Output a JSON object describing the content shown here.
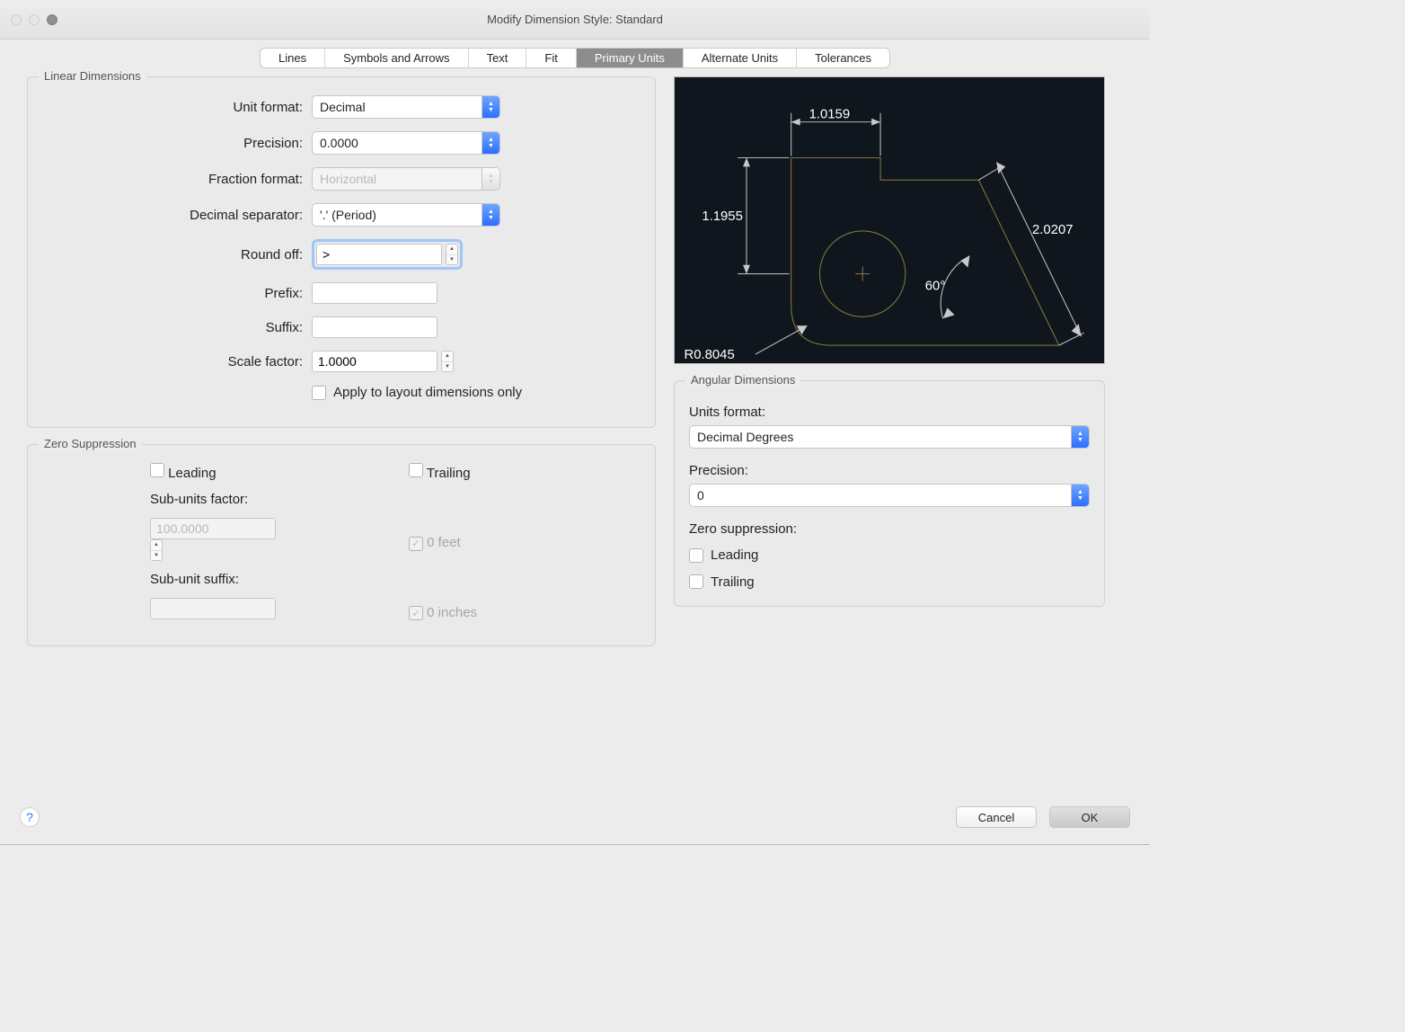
{
  "window": {
    "title": "Modify Dimension Style: Standard"
  },
  "tabs": {
    "items": [
      "Lines",
      "Symbols and Arrows",
      "Text",
      "Fit",
      "Primary Units",
      "Alternate Units",
      "Tolerances"
    ],
    "active": 4
  },
  "linear": {
    "legend": "Linear Dimensions",
    "unit_format_label": "Unit format:",
    "unit_format_value": "Decimal",
    "precision_label": "Precision:",
    "precision_value": "0.0000",
    "fraction_format_label": "Fraction format:",
    "fraction_format_value": "Horizontal",
    "decimal_separator_label": "Decimal separator:",
    "decimal_separator_value": "'.' (Period)",
    "round_off_label": "Round off:",
    "round_off_value": ">",
    "prefix_label": "Prefix:",
    "prefix_value": "",
    "suffix_label": "Suffix:",
    "suffix_value": "",
    "scale_factor_label": "Scale factor:",
    "scale_factor_value": "1.0000",
    "apply_layout_label": "Apply to layout dimensions only",
    "apply_layout_checked": false
  },
  "zero": {
    "legend": "Zero Suppression",
    "leading_label": "Leading",
    "trailing_label": "Trailing",
    "subunits_factor_label": "Sub-units factor:",
    "subunits_factor_value": "100.0000",
    "subunit_suffix_label": "Sub-unit suffix:",
    "subunit_suffix_value": "",
    "zero_feet_label": "0 feet",
    "zero_inches_label": "0 inches"
  },
  "preview": {
    "dim_top": "1.0159",
    "dim_left": "1.1955",
    "dim_diag": "2.0207",
    "angle": "60°",
    "radius": "R0.8045"
  },
  "angular": {
    "legend": "Angular Dimensions",
    "units_format_label": "Units format:",
    "units_format_value": "Decimal Degrees",
    "precision_label": "Precision:",
    "precision_value": "0",
    "zero_suppression_label": "Zero suppression:",
    "leading_label": "Leading",
    "trailing_label": "Trailing"
  },
  "footer": {
    "cancel": "Cancel",
    "ok": "OK"
  }
}
